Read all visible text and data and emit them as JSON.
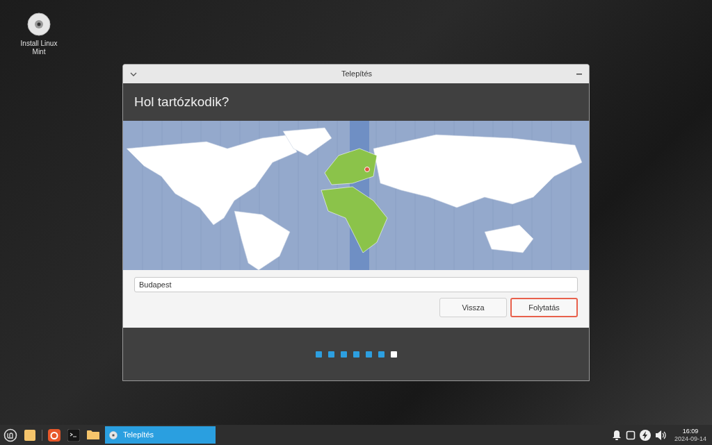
{
  "desktop_icons": [
    {
      "label": "Install Linux Mint"
    }
  ],
  "window": {
    "title": "Telepítés",
    "heading": "Hol tartózkodik?"
  },
  "location_field": {
    "value": "Budapest"
  },
  "buttons": [
    {
      "label": "Vissza",
      "kind": "normal"
    },
    {
      "label": "Folytatás",
      "kind": "default"
    }
  ],
  "steps": [
    {
      "selected": false
    },
    {
      "selected": false
    },
    {
      "selected": false
    },
    {
      "selected": false
    },
    {
      "selected": false
    },
    {
      "selected": false
    },
    {
      "selected": true
    }
  ],
  "taskbar": {
    "tasks": [
      {
        "label": "Telepítés",
        "selected": true
      }
    ],
    "clock": {
      "time": "16:09",
      "date": "2024-09-14"
    }
  }
}
